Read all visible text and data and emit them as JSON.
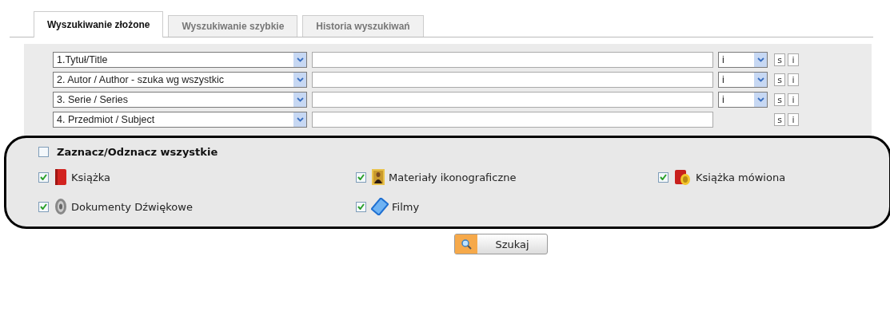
{
  "tabs": [
    {
      "label": "Wyszukiwanie złożone",
      "selected": true
    },
    {
      "label": "Wyszukiwanie szybkie",
      "selected": false
    },
    {
      "label": "Historia wyszukiwań",
      "selected": false
    }
  ],
  "rows": [
    {
      "field": "1.Tytuł/Title",
      "operator": "i",
      "buttons": [
        "s",
        "i"
      ]
    },
    {
      "field": "2. Autor / Author - szuka wg wszystkic",
      "operator": "i",
      "buttons": [
        "s",
        "i"
      ]
    },
    {
      "field": "3. Serie / Series",
      "operator": "i",
      "buttons": [
        "s",
        "i"
      ]
    },
    {
      "field": "4. Przedmiot / Subject",
      "buttons": [
        "s",
        "i"
      ]
    }
  ],
  "select_all": {
    "label": "Zaznacz/Odznacz wszystkie",
    "checked": false
  },
  "media": [
    {
      "label": "Książka",
      "checked": true,
      "kind": "book"
    },
    {
      "label": "Materiały ikonograficzne",
      "checked": true,
      "kind": "painting"
    },
    {
      "label": "Książka mówiona",
      "checked": true,
      "kind": "audiobook"
    },
    {
      "label": "Dokumenty Dźwiękowe",
      "checked": true,
      "kind": "speaker"
    },
    {
      "label": "Filmy",
      "checked": true,
      "kind": "film"
    }
  ],
  "search_button": {
    "label": "Szukaj"
  }
}
